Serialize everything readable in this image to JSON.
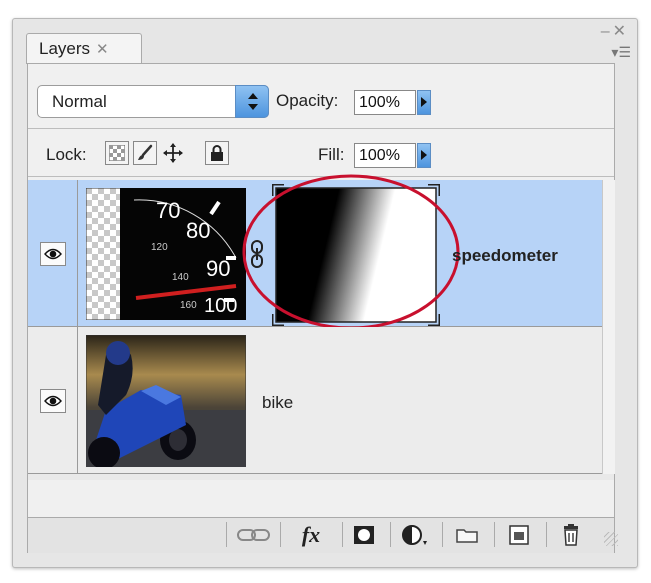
{
  "panel": {
    "tab_label": "Layers",
    "tab_close_glyph": "✕",
    "window_controls": "–✕",
    "panel_menu_glyph": "▾☰"
  },
  "blend_mode": {
    "value": "Normal"
  },
  "opacity": {
    "label": "Opacity:",
    "value": "100%"
  },
  "lock": {
    "label": "Lock:"
  },
  "fill": {
    "label": "Fill:",
    "value": "100%"
  },
  "layers": [
    {
      "name": "speedometer",
      "selected": true,
      "visible": true,
      "has_mask": true,
      "thumb_labels": [
        "70",
        "80",
        "90",
        "100",
        "120",
        "140",
        "160"
      ]
    },
    {
      "name": "bike",
      "selected": false,
      "visible": true,
      "has_mask": false
    }
  ],
  "bottom_icons": [
    "link-layers-icon",
    "fx-icon",
    "add-mask-icon",
    "adjustment-layer-icon",
    "new-group-icon",
    "new-layer-icon",
    "trash-icon"
  ],
  "fx_label": "fx",
  "colors": {
    "selection": "#b7d3f7",
    "accent_blue": "#4d94de",
    "mask_circle": "#c8102e"
  }
}
